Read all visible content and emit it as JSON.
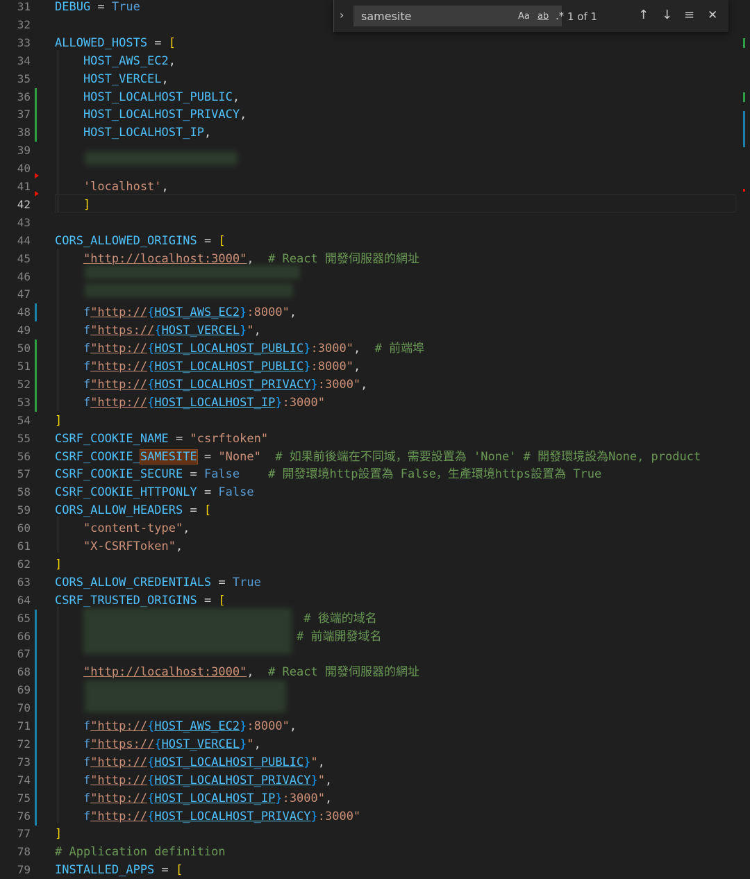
{
  "find": {
    "query": "samesite",
    "opt_case": "Aa",
    "opt_word": "ab",
    "opt_regex": ".*",
    "count": "1 of 1",
    "prev": "↑",
    "next": "↓",
    "select": "≡",
    "close": "✕",
    "toggle": "›"
  },
  "lines": [
    {
      "n": "31",
      "tokens": [
        {
          "t": "DEBUG",
          "c": "t-var"
        },
        {
          "t": " = ",
          "c": "t-op"
        },
        {
          "t": "True",
          "c": "t-kw"
        }
      ]
    },
    {
      "n": "32",
      "tokens": []
    },
    {
      "n": "33",
      "tokens": [
        {
          "t": "ALLOWED_HOSTS",
          "c": "t-var"
        },
        {
          "t": " = ",
          "c": "t-op"
        },
        {
          "t": "[",
          "c": "t-br"
        }
      ]
    },
    {
      "n": "34",
      "tokens": [
        {
          "t": "    HOST_AWS_EC2",
          "c": "t-var"
        },
        {
          "t": ",",
          "c": "t-op"
        }
      ]
    },
    {
      "n": "35",
      "tokens": [
        {
          "t": "    HOST_VERCEL",
          "c": "t-var"
        },
        {
          "t": ",",
          "c": "t-op"
        }
      ]
    },
    {
      "n": "36",
      "tokens": [
        {
          "t": "    HOST_LOCALHOST_PUBLIC",
          "c": "t-var"
        },
        {
          "t": ",",
          "c": "t-op"
        }
      ]
    },
    {
      "n": "37",
      "tokens": [
        {
          "t": "    HOST_LOCALHOST_PRIVACY",
          "c": "t-var"
        },
        {
          "t": ",",
          "c": "t-op"
        }
      ]
    },
    {
      "n": "38",
      "tokens": [
        {
          "t": "    HOST_LOCALHOST_IP",
          "c": "t-var"
        },
        {
          "t": ",",
          "c": "t-op"
        }
      ]
    },
    {
      "n": "39",
      "tokens": []
    },
    {
      "n": "40",
      "tokens": []
    },
    {
      "n": "41",
      "tokens": [
        {
          "t": "    'localhost'",
          "c": "t-str"
        },
        {
          "t": ",",
          "c": "t-op"
        }
      ]
    },
    {
      "n": "42",
      "tokens": [
        {
          "t": "    ]",
          "c": "t-br"
        }
      ]
    },
    {
      "n": "43",
      "tokens": []
    },
    {
      "n": "44",
      "tokens": [
        {
          "t": "CORS_ALLOWED_ORIGINS",
          "c": "t-var"
        },
        {
          "t": " = ",
          "c": "t-op"
        },
        {
          "t": "[",
          "c": "t-br"
        }
      ]
    },
    {
      "n": "45",
      "tokens": [
        {
          "t": "    ",
          "c": "t-op"
        },
        {
          "t": "\"http://localhost:3000\"",
          "c": "t-str-u"
        },
        {
          "t": ",  ",
          "c": "t-op"
        },
        {
          "t": "# React 開發伺服器的網址",
          "c": "t-com"
        }
      ]
    },
    {
      "n": "46",
      "tokens": []
    },
    {
      "n": "47",
      "tokens": []
    },
    {
      "n": "48",
      "tokens": [
        {
          "t": "    f",
          "c": "t-kw"
        },
        {
          "t": "\"http://",
          "c": "t-str-u"
        },
        {
          "t": "{",
          "c": "t-br3"
        },
        {
          "t": "HOST_AWS_EC2",
          "c": "t-var-u"
        },
        {
          "t": "}",
          "c": "t-br3"
        },
        {
          "t": ":8000\"",
          "c": "t-str"
        },
        {
          "t": ",",
          "c": "t-op"
        }
      ]
    },
    {
      "n": "49",
      "tokens": [
        {
          "t": "    f",
          "c": "t-kw"
        },
        {
          "t": "\"https://",
          "c": "t-str-u"
        },
        {
          "t": "{",
          "c": "t-br3"
        },
        {
          "t": "HOST_VERCEL",
          "c": "t-var-u"
        },
        {
          "t": "}",
          "c": "t-br3"
        },
        {
          "t": "\"",
          "c": "t-str"
        },
        {
          "t": ",",
          "c": "t-op"
        }
      ]
    },
    {
      "n": "50",
      "tokens": [
        {
          "t": "    f",
          "c": "t-kw"
        },
        {
          "t": "\"http://",
          "c": "t-str-u"
        },
        {
          "t": "{",
          "c": "t-br3"
        },
        {
          "t": "HOST_LOCALHOST_PUBLIC",
          "c": "t-var-u"
        },
        {
          "t": "}",
          "c": "t-br3"
        },
        {
          "t": ":3000\"",
          "c": "t-str"
        },
        {
          "t": ",  ",
          "c": "t-op"
        },
        {
          "t": "# 前端埠",
          "c": "t-com"
        }
      ]
    },
    {
      "n": "51",
      "tokens": [
        {
          "t": "    f",
          "c": "t-kw"
        },
        {
          "t": "\"http://",
          "c": "t-str-u"
        },
        {
          "t": "{",
          "c": "t-br3"
        },
        {
          "t": "HOST_LOCALHOST_PUBLIC",
          "c": "t-var-u"
        },
        {
          "t": "}",
          "c": "t-br3"
        },
        {
          "t": ":8000\"",
          "c": "t-str"
        },
        {
          "t": ",",
          "c": "t-op"
        }
      ]
    },
    {
      "n": "52",
      "tokens": [
        {
          "t": "    f",
          "c": "t-kw"
        },
        {
          "t": "\"http://",
          "c": "t-str-u"
        },
        {
          "t": "{",
          "c": "t-br3"
        },
        {
          "t": "HOST_LOCALHOST_PRIVACY",
          "c": "t-var-u"
        },
        {
          "t": "}",
          "c": "t-br3"
        },
        {
          "t": ":3000\"",
          "c": "t-str"
        },
        {
          "t": ",",
          "c": "t-op"
        }
      ]
    },
    {
      "n": "53",
      "tokens": [
        {
          "t": "    f",
          "c": "t-kw"
        },
        {
          "t": "\"http://",
          "c": "t-str-u"
        },
        {
          "t": "{",
          "c": "t-br3"
        },
        {
          "t": "HOST_LOCALHOST_IP",
          "c": "t-var-u"
        },
        {
          "t": "}",
          "c": "t-br3"
        },
        {
          "t": ":3000\"",
          "c": "t-str"
        }
      ]
    },
    {
      "n": "54",
      "tokens": [
        {
          "t": "]",
          "c": "t-br"
        }
      ]
    },
    {
      "n": "55",
      "tokens": [
        {
          "t": "CSRF_COOKIE_NAME",
          "c": "t-var"
        },
        {
          "t": " = ",
          "c": "t-op"
        },
        {
          "t": "\"csrftoken\"",
          "c": "t-str"
        }
      ]
    },
    {
      "n": "56",
      "tokens": [
        {
          "t": "CSRF_COOKIE_",
          "c": "t-var"
        },
        {
          "t": "SAMESITE",
          "c": "t-var t-hl"
        },
        {
          "t": " = ",
          "c": "t-op"
        },
        {
          "t": "\"None\"",
          "c": "t-str"
        },
        {
          "t": "  # 如果前後端在不同域，需要設置為 'None' # 開發環境設為None, product",
          "c": "t-com"
        }
      ]
    },
    {
      "n": "57",
      "tokens": [
        {
          "t": "CSRF_COOKIE_SECURE",
          "c": "t-var"
        },
        {
          "t": " = ",
          "c": "t-op"
        },
        {
          "t": "False",
          "c": "t-kw"
        },
        {
          "t": "    # 開發環境http設置為 False，生產環境https設置為 True",
          "c": "t-com"
        }
      ]
    },
    {
      "n": "58",
      "tokens": [
        {
          "t": "CSRF_COOKIE_HTTPONLY",
          "c": "t-var"
        },
        {
          "t": " = ",
          "c": "t-op"
        },
        {
          "t": "False",
          "c": "t-kw"
        }
      ]
    },
    {
      "n": "59",
      "tokens": [
        {
          "t": "CORS_ALLOW_HEADERS",
          "c": "t-var"
        },
        {
          "t": " = ",
          "c": "t-op"
        },
        {
          "t": "[",
          "c": "t-br"
        }
      ]
    },
    {
      "n": "60",
      "tokens": [
        {
          "t": "    \"content-type\"",
          "c": "t-str"
        },
        {
          "t": ",",
          "c": "t-op"
        }
      ]
    },
    {
      "n": "61",
      "tokens": [
        {
          "t": "    \"X-CSRFToken\"",
          "c": "t-str"
        },
        {
          "t": ",",
          "c": "t-op"
        }
      ]
    },
    {
      "n": "62",
      "tokens": [
        {
          "t": "]",
          "c": "t-br"
        }
      ]
    },
    {
      "n": "63",
      "tokens": [
        {
          "t": "CORS_ALLOW_CREDENTIALS",
          "c": "t-var"
        },
        {
          "t": " = ",
          "c": "t-op"
        },
        {
          "t": "True",
          "c": "t-kw"
        }
      ]
    },
    {
      "n": "64",
      "tokens": [
        {
          "t": "CSRF_TRUSTED_ORIGINS",
          "c": "t-var"
        },
        {
          "t": " = ",
          "c": "t-op"
        },
        {
          "t": "[",
          "c": "t-br"
        }
      ]
    },
    {
      "n": "65",
      "tokens": [
        {
          "t": "                                   # 後端的域名",
          "c": "t-com"
        }
      ]
    },
    {
      "n": "66",
      "tokens": [
        {
          "t": "                                  # 前端開發域名",
          "c": "t-com"
        }
      ]
    },
    {
      "n": "67",
      "tokens": []
    },
    {
      "n": "68",
      "tokens": [
        {
          "t": "    ",
          "c": "t-op"
        },
        {
          "t": "\"http://localhost:3000\"",
          "c": "t-str-u"
        },
        {
          "t": ",  ",
          "c": "t-op"
        },
        {
          "t": "# React 開發伺服器的網址",
          "c": "t-com"
        }
      ]
    },
    {
      "n": "69",
      "tokens": []
    },
    {
      "n": "70",
      "tokens": []
    },
    {
      "n": "71",
      "tokens": [
        {
          "t": "    f",
          "c": "t-kw"
        },
        {
          "t": "\"http://",
          "c": "t-str-u"
        },
        {
          "t": "{",
          "c": "t-br3"
        },
        {
          "t": "HOST_AWS_EC2",
          "c": "t-var-u"
        },
        {
          "t": "}",
          "c": "t-br3"
        },
        {
          "t": ":8000\"",
          "c": "t-str"
        },
        {
          "t": ",",
          "c": "t-op"
        }
      ]
    },
    {
      "n": "72",
      "tokens": [
        {
          "t": "    f",
          "c": "t-kw"
        },
        {
          "t": "\"https://",
          "c": "t-str-u"
        },
        {
          "t": "{",
          "c": "t-br3"
        },
        {
          "t": "HOST_VERCEL",
          "c": "t-var-u"
        },
        {
          "t": "}",
          "c": "t-br3"
        },
        {
          "t": "\"",
          "c": "t-str"
        },
        {
          "t": ",",
          "c": "t-op"
        }
      ]
    },
    {
      "n": "73",
      "tokens": [
        {
          "t": "    f",
          "c": "t-kw"
        },
        {
          "t": "\"http://",
          "c": "t-str-u"
        },
        {
          "t": "{",
          "c": "t-br3"
        },
        {
          "t": "HOST_LOCALHOST_PUBLIC",
          "c": "t-var-u"
        },
        {
          "t": "}",
          "c": "t-br3"
        },
        {
          "t": "\"",
          "c": "t-str"
        },
        {
          "t": ",",
          "c": "t-op"
        }
      ]
    },
    {
      "n": "74",
      "tokens": [
        {
          "t": "    f",
          "c": "t-kw"
        },
        {
          "t": "\"http://",
          "c": "t-str-u"
        },
        {
          "t": "{",
          "c": "t-br3"
        },
        {
          "t": "HOST_LOCALHOST_PRIVACY",
          "c": "t-var-u"
        },
        {
          "t": "}",
          "c": "t-br3"
        },
        {
          "t": "\"",
          "c": "t-str"
        },
        {
          "t": ",",
          "c": "t-op"
        }
      ]
    },
    {
      "n": "75",
      "tokens": [
        {
          "t": "    f",
          "c": "t-kw"
        },
        {
          "t": "\"http://",
          "c": "t-str-u"
        },
        {
          "t": "{",
          "c": "t-br3"
        },
        {
          "t": "HOST_LOCALHOST_IP",
          "c": "t-var-u"
        },
        {
          "t": "}",
          "c": "t-br3"
        },
        {
          "t": ":3000\"",
          "c": "t-str"
        },
        {
          "t": ",",
          "c": "t-op"
        }
      ]
    },
    {
      "n": "76",
      "tokens": [
        {
          "t": "    f",
          "c": "t-kw"
        },
        {
          "t": "\"http://",
          "c": "t-str-u"
        },
        {
          "t": "{",
          "c": "t-br3"
        },
        {
          "t": "HOST_LOCALHOST_PRIVACY",
          "c": "t-var-u"
        },
        {
          "t": "}",
          "c": "t-br3"
        },
        {
          "t": ":3000\"",
          "c": "t-str"
        }
      ]
    },
    {
      "n": "77",
      "tokens": [
        {
          "t": "]",
          "c": "t-br"
        }
      ]
    },
    {
      "n": "78",
      "tokens": [
        {
          "t": "# Application definition",
          "c": "t-com"
        }
      ]
    },
    {
      "n": "79",
      "tokens": [
        {
          "t": "INSTALLED_APPS",
          "c": "t-var"
        },
        {
          "t": " = ",
          "c": "t-op"
        },
        {
          "t": "[",
          "c": "t-br"
        }
      ]
    }
  ]
}
